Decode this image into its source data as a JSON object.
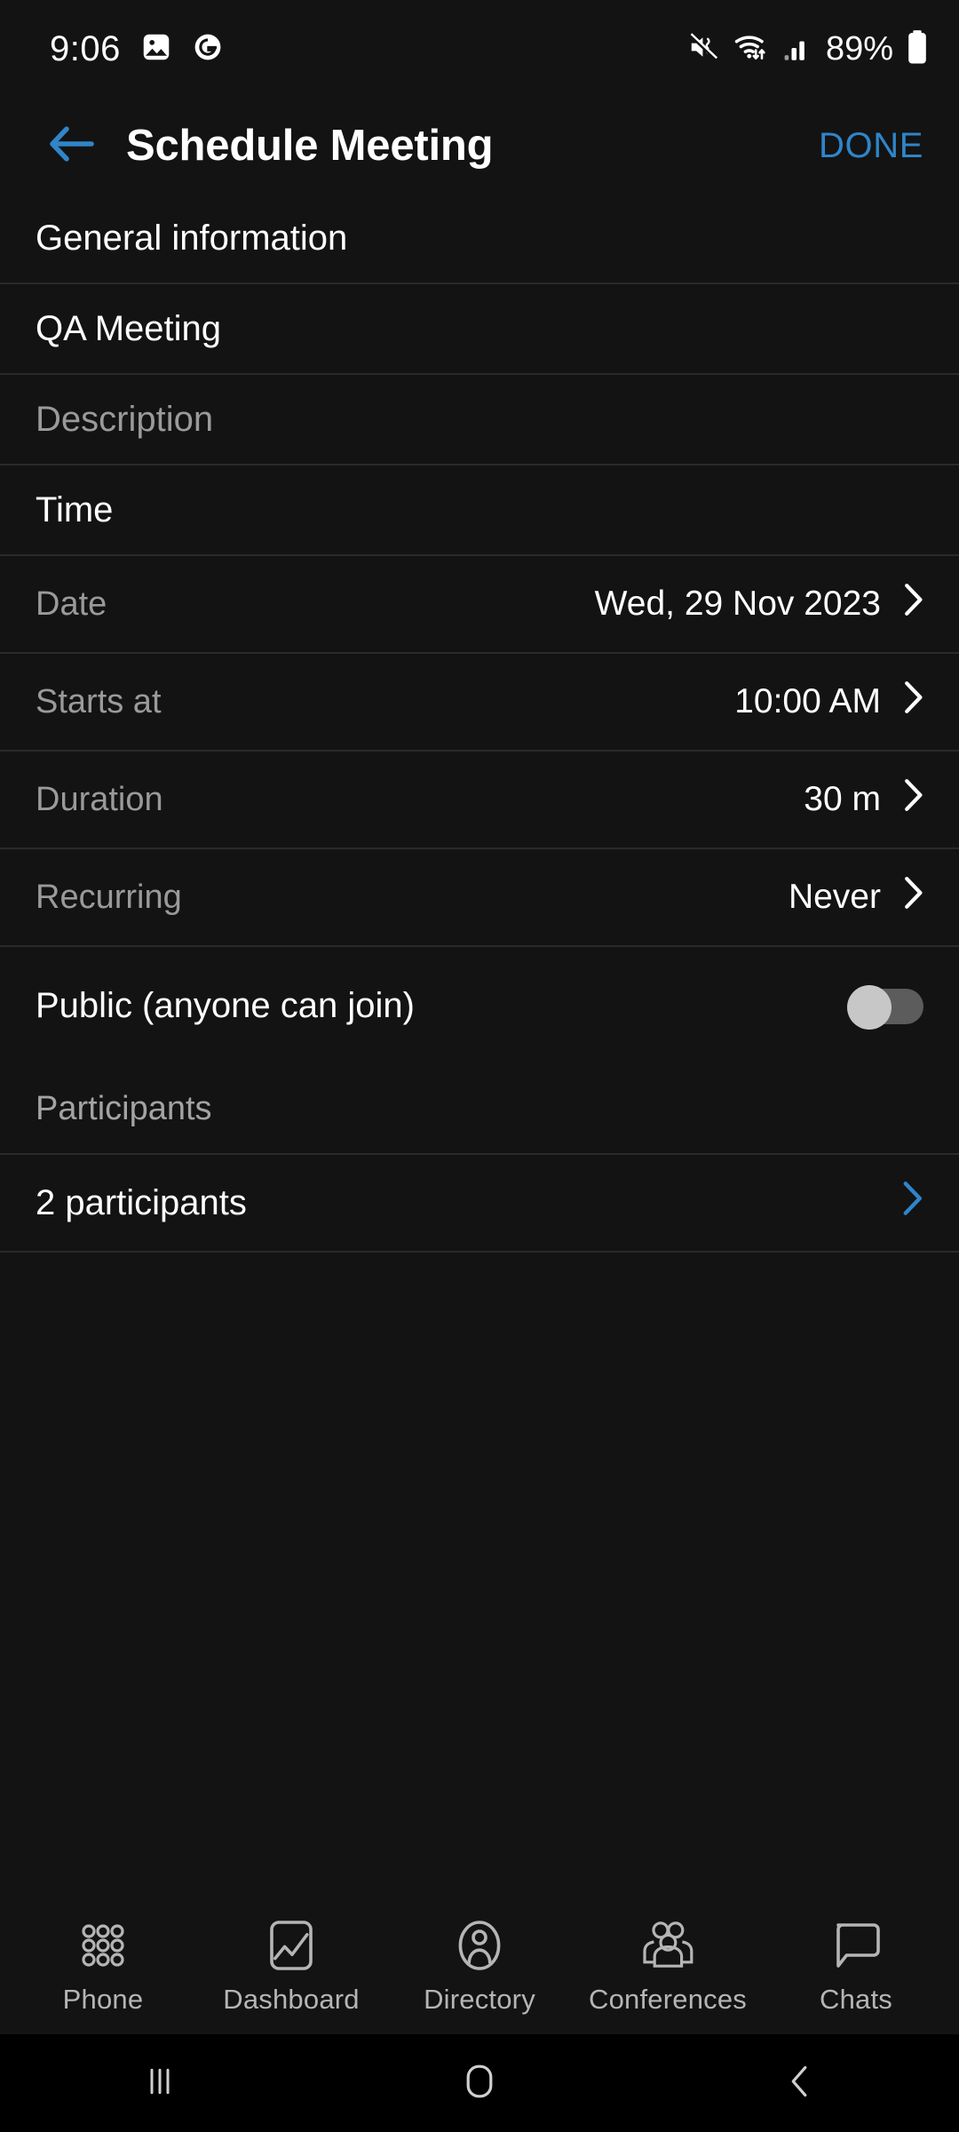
{
  "status_bar": {
    "time": "9:06",
    "left_icons": [
      "image-icon",
      "grammarly-icon"
    ],
    "right_icons": [
      "mute-vibrate-icon",
      "wifi-icon",
      "cellular-signal-icon",
      "battery-icon"
    ],
    "battery_percent": "89%"
  },
  "header": {
    "back_label": "back-arrow",
    "title": "Schedule Meeting",
    "done_label": "DONE",
    "accent_color": "#2f85c9"
  },
  "sections": {
    "general": {
      "title": "General information",
      "name_value": "QA Meeting",
      "description_placeholder": "Description"
    },
    "time": {
      "title": "Time",
      "rows": [
        {
          "label": "Date",
          "value": "Wed, 29 Nov 2023"
        },
        {
          "label": "Starts at",
          "value": "10:00 AM"
        },
        {
          "label": "Duration",
          "value": "30 m"
        },
        {
          "label": "Recurring",
          "value": "Never"
        }
      ]
    },
    "public": {
      "label": "Public (anyone can join)",
      "enabled": "off"
    },
    "participants": {
      "title": "Participants",
      "count_label": "2 participants"
    }
  },
  "tabbar": {
    "items": [
      {
        "label": "Phone",
        "icon": "keypad-icon"
      },
      {
        "label": "Dashboard",
        "icon": "chart-icon"
      },
      {
        "label": "Directory",
        "icon": "contact-icon"
      },
      {
        "label": "Conferences",
        "icon": "group-icon"
      },
      {
        "label": "Chats",
        "icon": "speech-bubble-icon"
      }
    ]
  },
  "system_nav": {
    "recents": "recents-icon",
    "home": "home-icon",
    "back": "back-icon"
  }
}
